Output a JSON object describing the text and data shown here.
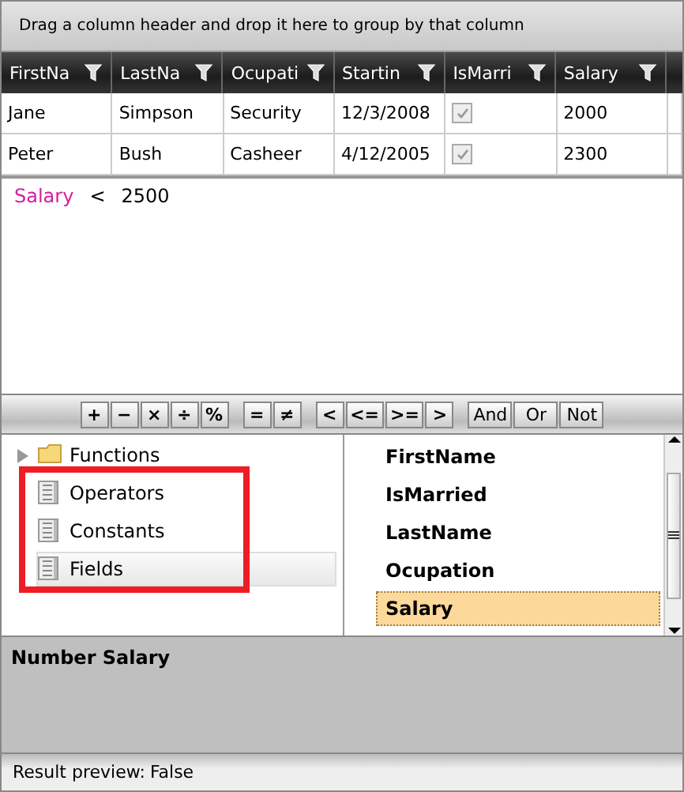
{
  "group_panel": {
    "hint": "Drag a column header and drop it here to group by that column"
  },
  "grid": {
    "columns": [
      {
        "header": "FirstNa",
        "kind": "text"
      },
      {
        "header": "LastNa",
        "kind": "text"
      },
      {
        "header": "Ocupati",
        "kind": "text"
      },
      {
        "header": "Startin",
        "kind": "text"
      },
      {
        "header": "IsMarri",
        "kind": "check"
      },
      {
        "header": "Salary",
        "kind": "text"
      }
    ],
    "rows": [
      {
        "cells": [
          "Jane",
          "Simpson",
          "Security",
          "12/3/2008",
          {
            "checked": true
          },
          "2000"
        ]
      },
      {
        "cells": [
          "Peter",
          "Bush",
          "Casheer",
          "4/12/2005",
          {
            "checked": true
          },
          "2300"
        ]
      }
    ]
  },
  "expression": [
    {
      "text": "Salary",
      "kind": "field"
    },
    {
      "text": "<",
      "kind": "operator"
    },
    {
      "text": "2500",
      "kind": "value"
    }
  ],
  "toolbar": [
    [
      "+",
      "−",
      "×",
      "÷",
      "%"
    ],
    [
      "=",
      "≠"
    ],
    [
      "<",
      "<=",
      ">=",
      ">"
    ],
    [
      "And",
      "Or",
      "Not"
    ]
  ],
  "tree": [
    {
      "label": "Functions",
      "kind": "folder",
      "expanded": false,
      "selected": false
    },
    {
      "label": "Operators",
      "kind": "list",
      "selected": false
    },
    {
      "label": "Constants",
      "kind": "list",
      "selected": false
    },
    {
      "label": "Fields",
      "kind": "list",
      "selected": true
    }
  ],
  "fields": [
    {
      "label": "FirstName",
      "selected": false
    },
    {
      "label": "IsMarried",
      "selected": false
    },
    {
      "label": "LastName",
      "selected": false
    },
    {
      "label": "Ocupation",
      "selected": false
    },
    {
      "label": "Salary",
      "selected": true
    }
  ],
  "description": "Number Salary",
  "status_bar": {
    "label": "Result preview:",
    "value": "False"
  }
}
